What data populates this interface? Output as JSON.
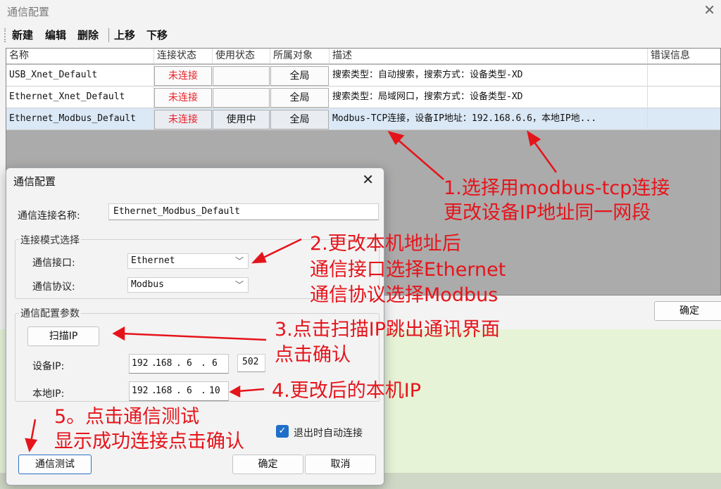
{
  "main_window": {
    "title": "通信配置",
    "toolbar": {
      "new": "新建",
      "edit": "编辑",
      "delete": "删除",
      "move_up": "上移",
      "move_down": "下移"
    },
    "columns": [
      "名称",
      "连接状态",
      "使用状态",
      "所属对象",
      "描述",
      "错误信息"
    ],
    "rows": [
      {
        "name": "USB_Xnet_Default",
        "conn": "未连接",
        "use": "",
        "owner": "全局",
        "desc": "搜索类型：自动搜索，搜索方式：设备类型-XD",
        "error": ""
      },
      {
        "name": "Ethernet_Xnet_Default",
        "conn": "未连接",
        "use": "",
        "owner": "全局",
        "desc": "搜索类型：局域网口，搜索方式：设备类型-XD",
        "error": ""
      },
      {
        "name": "Ethernet_Modbus_Default",
        "conn": "未连接",
        "use": "使用中",
        "owner": "全局",
        "desc": "Modbus-TCP连接，设备IP地址：192.168.6.6，本地IP地...",
        "error": ""
      }
    ],
    "ok_button": "确定"
  },
  "dialog": {
    "title": "通信配置",
    "conn_name_label": "通信连接名称:",
    "conn_name_value": "Ethernet_Modbus_Default",
    "mode_group": "连接模式选择",
    "interface_label": "通信接口:",
    "interface_value": "Ethernet",
    "protocol_label": "通信协议:",
    "protocol_value": "Modbus",
    "params_group": "通信配置参数",
    "scan_ip_button": "扫描IP",
    "device_ip_label": "设备IP:",
    "device_ip": [
      "192",
      "168",
      "6",
      "6"
    ],
    "port": "502",
    "local_ip_label": "本地IP:",
    "local_ip": [
      "192",
      "168",
      "6",
      "10"
    ],
    "auto_connect_label": "退出时自动连接",
    "auto_connect_checked": true,
    "test_button": "通信测试",
    "ok_button": "确定",
    "cancel_button": "取消"
  },
  "annotations": {
    "a1_line1": "1.选择用modbus-tcp连接",
    "a1_line2": "更改设备IP地址同一网段",
    "a2_line1": "2.更改本机地址后",
    "a2_line2": "通信接口选择Ethernet",
    "a2_line3": "通信协议选择Modbus",
    "a3_line1": "3.点击扫描IP跳出通讯界面",
    "a3_line2": "点击确认",
    "a4_line1": "4.更改后的本机IP",
    "a5_line1": "5。点击通信测试",
    "a5_line2": "显示成功连接点击确认",
    "color": "#e5141b"
  },
  "colors": {
    "accent": "#1f6fc9",
    "status_red": "#e8222a",
    "selected_row": "#dbe8f5",
    "desktop": "#e6f3d6"
  }
}
